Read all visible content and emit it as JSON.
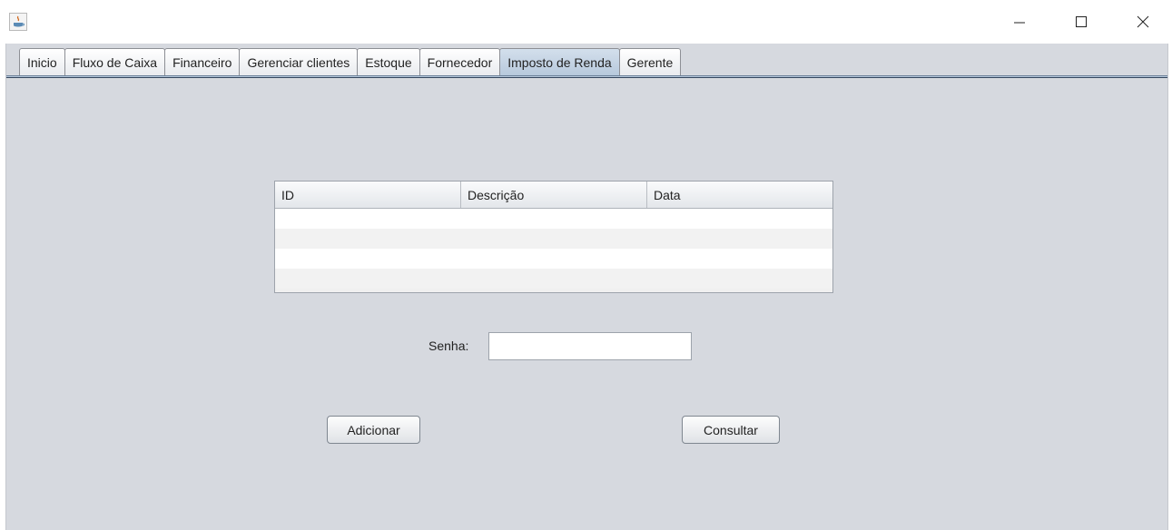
{
  "window": {
    "icon": "java-app-icon",
    "controls": {
      "minimize": "minimize-icon",
      "maximize": "maximize-icon",
      "close": "close-icon"
    }
  },
  "tabs": [
    {
      "label": "Inicio",
      "selected": false
    },
    {
      "label": "Fluxo de Caixa",
      "selected": false
    },
    {
      "label": "Financeiro",
      "selected": false
    },
    {
      "label": "Gerenciar clientes",
      "selected": false
    },
    {
      "label": "Estoque",
      "selected": false
    },
    {
      "label": "Fornecedor",
      "selected": false
    },
    {
      "label": "Imposto de Renda",
      "selected": true
    },
    {
      "label": "Gerente",
      "selected": false
    }
  ],
  "table": {
    "columns": [
      "ID",
      "Descrição",
      "Data"
    ],
    "rows": []
  },
  "form": {
    "senha_label": "Senha:",
    "senha_value": ""
  },
  "buttons": {
    "add": "Adicionar",
    "query": "Consultar"
  },
  "colors": {
    "panel_bg": "#d6d9df",
    "selected_tab": "#b7c9dc"
  }
}
